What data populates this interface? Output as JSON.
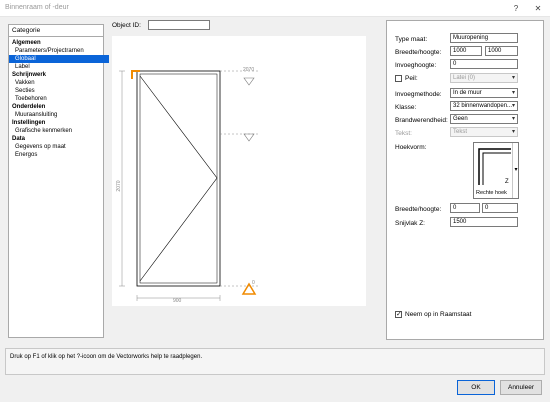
{
  "window": {
    "title": "Binnenraam of -deur",
    "help_glyph": "?",
    "close_glyph": "✕"
  },
  "category": {
    "header": "Categorie",
    "items": [
      {
        "label": "Algemeen",
        "kind": "b"
      },
      {
        "label": "Parameters/Projectrarnen",
        "kind": "s"
      },
      {
        "label": "Globaal",
        "kind": "s",
        "selected": true
      },
      {
        "label": "Label",
        "kind": "s"
      },
      {
        "label": "Schrijnwerk",
        "kind": "b"
      },
      {
        "label": "Vakken",
        "kind": "s"
      },
      {
        "label": "Secties",
        "kind": "s"
      },
      {
        "label": "Toebehoren",
        "kind": "s"
      },
      {
        "label": "Onderdelen",
        "kind": "b"
      },
      {
        "label": "Muuraansluiting",
        "kind": "s"
      },
      {
        "label": "Instellingen",
        "kind": "b"
      },
      {
        "label": "Grafische kenmerken",
        "kind": "s"
      },
      {
        "label": "Data",
        "kind": "b"
      },
      {
        "label": "Gegevens op maat",
        "kind": "s"
      },
      {
        "label": "Energos",
        "kind": "s"
      }
    ]
  },
  "object_id": {
    "label": "Object ID:",
    "value": ""
  },
  "preview": {
    "dim_top": "2070",
    "dim_left": "2070",
    "dim_bottom": "900",
    "dim_zero": "0"
  },
  "props": {
    "type_label": "Type maat:",
    "type_value": "Muuropening",
    "bh_label": "Breedte/hoogte:",
    "width": "1000",
    "height": "1000",
    "invoeg_label": "Invoeghoogte:",
    "invoeg_value": "0",
    "peil_label": "Peil:",
    "peil_value": "Latei (0)",
    "methode_label": "Invoegmethode:",
    "methode_value": "In de muur",
    "klasse_label": "Klasse:",
    "klasse_value": "32 binnenwandopen...",
    "brand_label": "Brandwerendheid:",
    "brand_value": "Geen",
    "tekst_label": "Tekst:",
    "tekst_value": "Tekst",
    "hoek_label": "Hoekvorm:",
    "hoek_value": "Rechte hoek",
    "bh2_label": "Breedte/hoogte:",
    "bh2_w": "0",
    "bh2_h": "0",
    "snijvlak_label": "Snijvlak Z:",
    "snijvlak_value": "1500",
    "neem_label": "Neem op in Raamstaat"
  },
  "help_text": "Druk op F1 of klik op het ?-icoon om de Vectorworks help te raadplegen.",
  "buttons": {
    "ok": "OK",
    "cancel": "Annuleer"
  }
}
